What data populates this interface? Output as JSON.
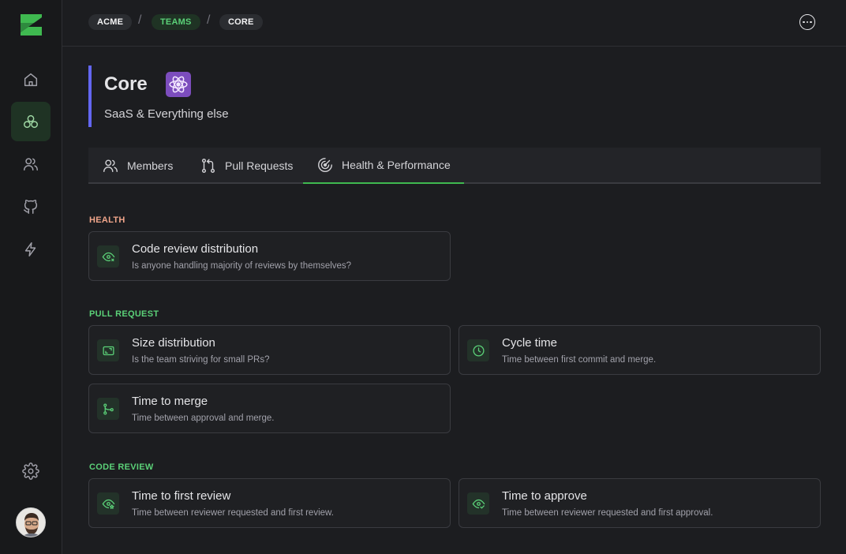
{
  "breadcrumb": [
    "ACME",
    "TEAMS",
    "CORE"
  ],
  "breadcrumb_separator": "/",
  "team": {
    "title": "Core",
    "subtitle": "SaaS & Everything else",
    "accent_color": "#6366f1",
    "icon": "atom-icon"
  },
  "sidebar": {
    "items": [
      "home-icon",
      "teams-icon",
      "users-icon",
      "github-icon",
      "lightning-icon"
    ],
    "active": "teams-icon",
    "bottom": [
      "settings-icon",
      "avatar"
    ]
  },
  "tabs": [
    {
      "label": "Members",
      "icon": "members-icon"
    },
    {
      "label": "Pull Requests",
      "icon": "pull-request-icon"
    },
    {
      "label": "Health & Performance",
      "icon": "radar-icon",
      "active": true
    }
  ],
  "sections": {
    "health": {
      "label": "HEALTH",
      "color": "#f0a58a",
      "cards": [
        {
          "title": "Code review distribution",
          "desc": "Is anyone handling majority of reviews by themselves?",
          "icon": "eye-icon"
        }
      ]
    },
    "pull_request": {
      "label": "PULL REQUEST",
      "color": "#5bd178",
      "cards": [
        {
          "title": "Size distribution",
          "desc": "Is the team striving for small PRs?",
          "icon": "frame-icon"
        },
        {
          "title": "Cycle time",
          "desc": "Time between first commit and merge.",
          "icon": "clock-icon"
        },
        {
          "title": "Time to merge",
          "desc": "Time between approval and merge.",
          "icon": "merge-icon"
        }
      ]
    },
    "code_review": {
      "label": "CODE REVIEW",
      "color": "#5bd178",
      "cards": [
        {
          "title": "Time to first review",
          "desc": "Time between reviewer requested and first review.",
          "icon": "eye-star-icon"
        },
        {
          "title": "Time to approve",
          "desc": "Time between reviewer requested and first approval.",
          "icon": "eye-check-icon"
        }
      ]
    }
  }
}
